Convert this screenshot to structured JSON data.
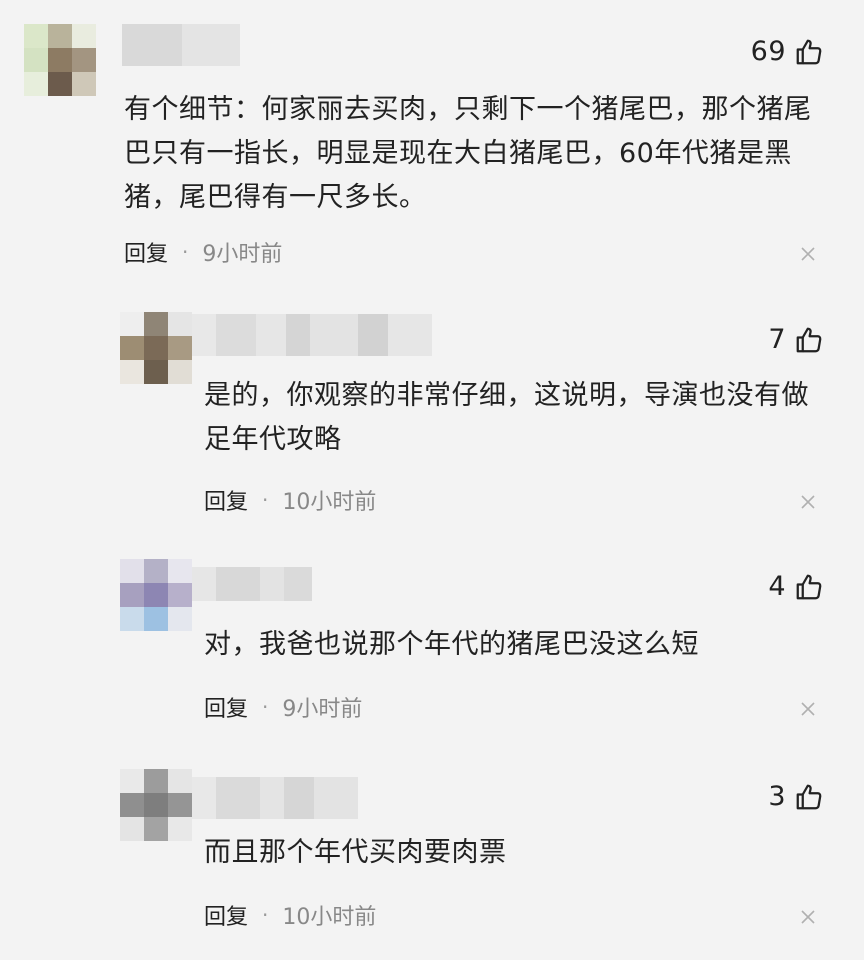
{
  "comments": [
    {
      "likes": "69",
      "text": "有个细节：何家丽去买肉，只剩下一个猪尾巴，那个猪尾巴只有一指长，明显是现在大白猪尾巴，60年代猪是黑猪，尾巴得有一尺多长。",
      "reply": "回复",
      "sep": "·",
      "time": "9小时前"
    },
    {
      "likes": "7",
      "text": "是的，你观察的非常仔细，这说明，导演也没有做足年代攻略",
      "reply": "回复",
      "sep": "·",
      "time": "10小时前"
    },
    {
      "likes": "4",
      "text": "对，我爸也说那个年代的猪尾巴没这么短",
      "reply": "回复",
      "sep": "·",
      "time": "9小时前"
    },
    {
      "likes": "3",
      "text": "而且那个年代买肉要肉票",
      "reply": "回复",
      "sep": "·",
      "time": "10小时前"
    }
  ],
  "icons": {
    "like": "thumbs-up-icon",
    "close": "close-icon"
  },
  "colors": {
    "background": "#f3f3f3",
    "text": "#222222",
    "secondary": "#888888"
  }
}
